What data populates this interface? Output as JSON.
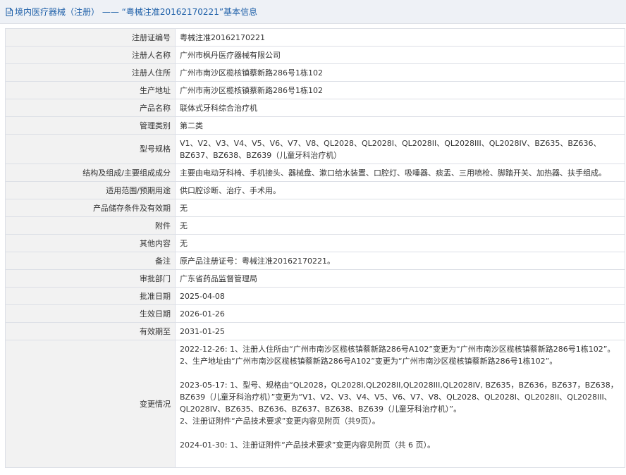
{
  "header": {
    "icon": "document-icon",
    "title": "境内医疗器械（注册） —— “粤械注准20162170221”基本信息"
  },
  "rows": [
    {
      "label": "注册证编号",
      "value": "粤械注准20162170221"
    },
    {
      "label": "注册人名称",
      "value": "广州市枫丹医疗器械有限公司"
    },
    {
      "label": "注册人住所",
      "value": "广州市南沙区榄核镇蔡新路286号1栋102"
    },
    {
      "label": "生产地址",
      "value": "广州市南沙区榄核镇蔡新路286号1栋102"
    },
    {
      "label": "产品名称",
      "value": "联体式牙科综合治疗机"
    },
    {
      "label": "管理类别",
      "value": "第二类"
    },
    {
      "label": "型号规格",
      "value": "V1、V2、V3、V4、V5、V6、V7、V8、QL2028、QL2028I、QL2028II、QL2028III、QL2028IV、BZ635、BZ636、BZ637、BZ638、BZ639（儿童牙科治疗机）"
    },
    {
      "label": "结构及组成/主要组成成分",
      "value": "主要由电动牙科椅、手机接头、器械盘、漱口给水装置、口腔灯、吸唾器、痰盂、三用喷枪、脚踏开关、加热器、扶手组成。"
    },
    {
      "label": "适用范围/预期用途",
      "value": "供口腔诊断、治疗、手术用。"
    },
    {
      "label": "产品储存条件及有效期",
      "value": "无"
    },
    {
      "label": "附件",
      "value": "无"
    },
    {
      "label": "其他内容",
      "value": "无"
    },
    {
      "label": "备注",
      "value": "原产品注册证号：粤械注准20162170221。"
    },
    {
      "label": "审批部门",
      "value": "广东省药品监督管理局"
    },
    {
      "label": "批准日期",
      "value": "2025-04-08"
    },
    {
      "label": "生效日期",
      "value": "2026-01-26"
    },
    {
      "label": "有效期至",
      "value": "2031-01-25"
    }
  ],
  "changes": {
    "label": "变更情况",
    "lines": [
      "2022-12-26: 1、注册人住所由“广州市南沙区榄核镇蔡新路286号A102”变更为“广州市南沙区榄核镇蔡新路286号1栋102”。",
      "2、生产地址由“广州市南沙区榄核镇蔡新路286号A102”变更为“广州市南沙区榄核镇蔡新路286号1栋102”。",
      "2023-05-17: 1、型号、规格由“QL2028，QL2028I,QL2028II,QL2028III,QL2028IV, BZ635，BZ636，BZ637，BZ638，BZ639（儿童牙科治疗机）”变更为“V1、V2、V3、V4、V5、V6、V7、V8、QL2028、QL2028I、QL2028II、QL2028III、QL2028IV、BZ635、BZ636、BZ637、BZ638、BZ639（儿童牙科治疗机）”。",
      "2、注册证附件“产品技术要求”变更内容见附页（共9页）。",
      "2024-01-30: 1、注册证附件“产品技术要求”变更内容见附页（共 6 页）。"
    ]
  }
}
